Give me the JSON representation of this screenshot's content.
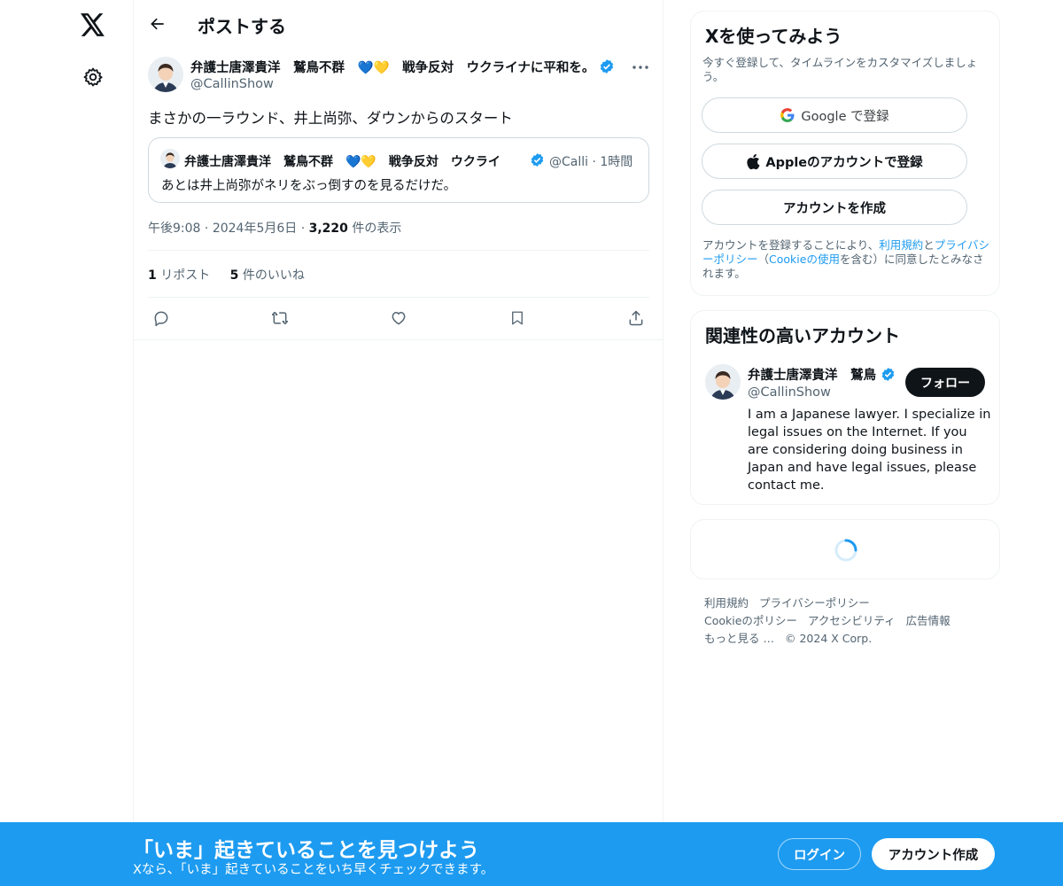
{
  "nav": {
    "logo_icon": "x-logo-icon",
    "settings_icon": "gear-icon"
  },
  "header": {
    "title": "ポストする"
  },
  "post": {
    "author_name": "弁護士唐澤貴洋　鷲鳥不群　💙💛　戦争反対　ウクライナに平和を。",
    "author_handle": "@CallinShow",
    "text": "まさかの一ラウンド、井上尚弥、ダウンからのスタート",
    "quote": {
      "author_name": "弁護士唐澤貴洋　鷲鳥不群　💙💛　戦争反対　ウクライ",
      "author_handle": "@Calli",
      "time": "1時間",
      "text": "あとは井上尚弥がネリをぶっ倒すのを見るだけだ。"
    },
    "time": "午後9:08",
    "date": "2024年5月6日",
    "views_count": "3,220",
    "views_label": "件の表示",
    "reposts_count": "1",
    "reposts_label": "リポスト",
    "likes_count": "5",
    "likes_label": "件のいいね"
  },
  "signup_card": {
    "title": "Xを使ってみよう",
    "subtitle": "今すぐ登録して、タイムラインをカスタマイズしましょう。",
    "google_label": "Google で登録",
    "apple_label": "Appleのアカウントで登録",
    "create_label": "アカウントを作成",
    "legal_1": "アカウントを登録することにより、",
    "legal_terms": "利用規約",
    "legal_2": "と",
    "legal_privacy": "プライバシーポリシー",
    "legal_3": "（",
    "legal_cookie": "Cookieの使用",
    "legal_4": "を含む）に同意したとみなされます。"
  },
  "related": {
    "title": "関連性の高いアカウント",
    "name": "弁護士唐澤貴洋　鷲鳥",
    "handle": "@CallinShow",
    "follow_label": "フォロー",
    "bio": "I am a Japanese lawyer. I specialize in legal issues on the Internet. If you are considering doing business in Japan and have legal issues, please contact me."
  },
  "footer": {
    "terms": "利用規約",
    "privacy": "プライバシーポリシー",
    "cookie": "Cookieのポリシー",
    "accessibility": "アクセシビリティ",
    "ads": "広告情報",
    "more": "もっと見る …",
    "copyright": "© 2024 X Corp."
  },
  "banner": {
    "title": "「いま」起きていることを見つけよう",
    "subtitle": "Xなら、「いま」起きていることをいち早くチェックできます。",
    "login_label": "ログイン",
    "signup_label": "アカウント作成"
  },
  "colors": {
    "accent": "#1d9bf0",
    "text": "#0f1419",
    "muted": "#536471"
  }
}
